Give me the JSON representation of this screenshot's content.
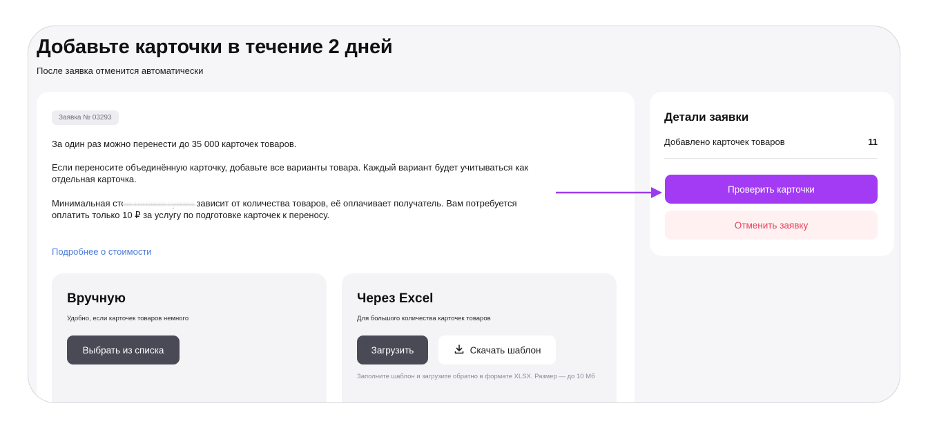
{
  "header": {
    "title": "Добавьте карточки в течение 2 дней",
    "subtitle": "После заявка отменится автоматически"
  },
  "main": {
    "request_badge": "Заявка № 03293",
    "paragraphs": [
      "За один раз можно перенести до 35 000 карточек товаров.",
      "Если переносите объединённую карточку, добавьте все варианты товара. Каждый вариант будет учитываться как отдельная карточка.",
      "Минимальная стои тоговая сумма зависит от количества товаров, её оплачивает получатель. Вам потребуется оплатить только 10 ₽ за услугу по подготовке карточек к переносу."
    ],
    "more_link": "Подробнее о стоимости",
    "manual": {
      "title": "Вручную",
      "description": "Удобно, если карточек товаров немного",
      "button": "Выбрать из списка"
    },
    "excel": {
      "title": "Через Excel",
      "description": "Для большого количества карточек товаров",
      "upload_button": "Загрузить",
      "template_button": "Скачать шаблон",
      "hint": "Заполните шаблон и загрузите обратно в формате XLSX. Размер — до 10 Мб"
    }
  },
  "details": {
    "title": "Детали заявки",
    "added_label": "Добавлено карточек товаров",
    "added_count": "11",
    "check_button": "Проверить карточки",
    "cancel_button": "Отменить заявку"
  },
  "colors": {
    "accent": "#a23bf3",
    "danger": "#e5415b",
    "dark_button": "#4a4a57",
    "link": "#4b7bd8"
  },
  "icons": {
    "download": "download-icon",
    "annotation": "arrow-right-icon"
  }
}
